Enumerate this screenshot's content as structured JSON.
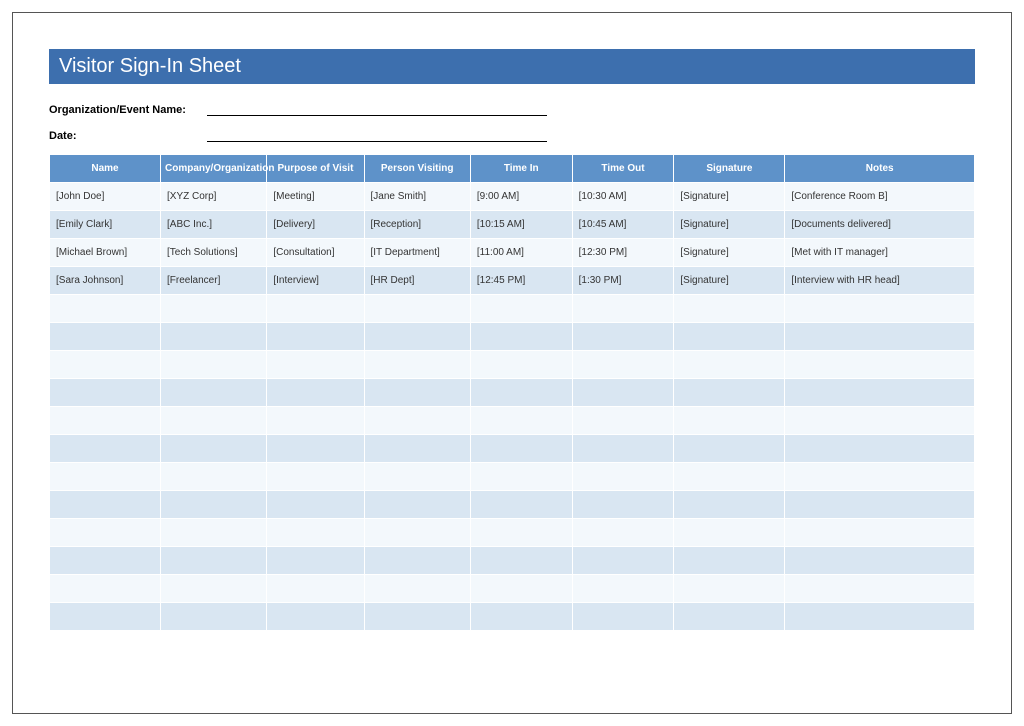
{
  "title": "Visitor Sign-In Sheet",
  "meta": {
    "org_label": "Organization/Event Name:",
    "date_label": "Date:"
  },
  "columns": [
    "Name",
    "Company/Organization",
    "Purpose of Visit",
    "Person Visiting",
    "Time In",
    "Time Out",
    "Signature",
    "Notes"
  ],
  "rows": [
    {
      "name": "[John Doe]",
      "company": "[XYZ Corp]",
      "purpose": "[Meeting]",
      "person": "[Jane Smith]",
      "time_in": "[9:00 AM]",
      "time_out": "[10:30 AM]",
      "signature": "[Signature]",
      "notes": "[Conference Room B]"
    },
    {
      "name": "[Emily Clark]",
      "company": "[ABC Inc.]",
      "purpose": "[Delivery]",
      "person": "[Reception]",
      "time_in": "[10:15 AM]",
      "time_out": "[10:45 AM]",
      "signature": "[Signature]",
      "notes": "[Documents delivered]"
    },
    {
      "name": "[Michael Brown]",
      "company": "[Tech Solutions]",
      "purpose": "[Consultation]",
      "person": "[IT Department]",
      "time_in": "[11:00 AM]",
      "time_out": "[12:30 PM]",
      "signature": "[Signature]",
      "notes": "[Met with IT manager]"
    },
    {
      "name": "[Sara Johnson]",
      "company": "[Freelancer]",
      "purpose": "[Interview]",
      "person": "[HR Dept]",
      "time_in": "[12:45 PM]",
      "time_out": "[1:30 PM]",
      "signature": "[Signature]",
      "notes": "[Interview with HR head]"
    }
  ],
  "empty_row_count": 12
}
